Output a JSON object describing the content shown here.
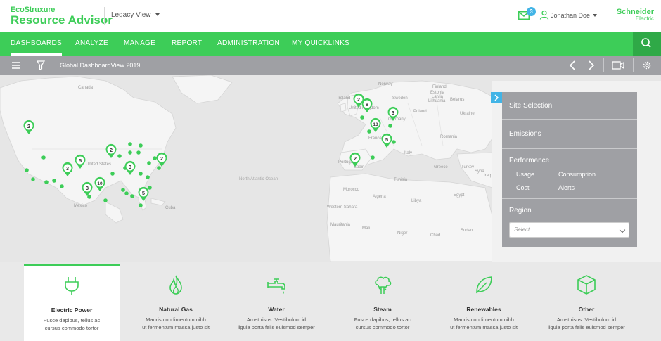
{
  "header": {
    "logo_eco": "EcoStruxure",
    "logo_product": "Resource Advisor",
    "view_selector": "Legacy View",
    "mail_badge": "3",
    "user_name": "Jonathan Doe",
    "brand": "Schneider",
    "brand_sub": "Electric"
  },
  "nav": {
    "items": [
      {
        "label": "DASHBOARDS",
        "active": true
      },
      {
        "label": "ANALYZE",
        "active": false
      },
      {
        "label": "MANAGE",
        "active": false
      },
      {
        "label": "REPORT",
        "active": false
      },
      {
        "label": "ADMINISTRATION",
        "active": false
      },
      {
        "label": "MY QUICKLINKS",
        "active": false
      }
    ]
  },
  "toolbar": {
    "title": "Global DashboardView 2019"
  },
  "map": {
    "labels": {
      "canada": "Canada",
      "united_states": "United States",
      "mexico": "Mexico",
      "sweden": "Sweden",
      "finland": "Finland",
      "norway": "Norway",
      "estonia": "Estonia",
      "latvia": "Latvia",
      "lithuania": "Lithuania",
      "poland": "Poland",
      "ukraine": "Ukraine",
      "germany": "Germany",
      "france": "France",
      "spain": "Spain",
      "portugal": "Portugal",
      "italy": "Italy",
      "turkey": "Turkey",
      "ireland": "Ireland",
      "united_kingdom": "United Kingdom",
      "belarus": "Belarus",
      "romania": "Romania",
      "greece": "Greece",
      "morocco": "Morocco",
      "algeria": "Algeria",
      "libya": "Libya",
      "egypt": "Egypt",
      "tunisia": "Tunisia",
      "syria": "Syria",
      "iraq": "Iraq",
      "cuba": "Cuba",
      "western_sahara": "Western Sahara",
      "mali": "Mali",
      "niger": "Niger",
      "chad": "Chad",
      "sudan": "Sudan",
      "mauritania": "Mauritania",
      "north_atlantic": "North Atlantic Ocean"
    },
    "cluster_counts": [
      "2",
      "5",
      "3",
      "2",
      "3",
      "2",
      "3",
      "10",
      "5",
      "2",
      "8",
      "3",
      "13",
      "5",
      "2"
    ]
  },
  "side_panel": {
    "site_selection": "Site Selection",
    "emissions": "Emissions",
    "performance": "Performance",
    "usage": "Usage",
    "consumption": "Consumption",
    "cost": "Cost",
    "alerts": "Alerts",
    "region": "Region",
    "region_placeholder": "Select"
  },
  "cards": [
    {
      "title": "Electric Power",
      "desc1": "Fusce dapibus, tellus ac",
      "desc2": "cursus commodo tortor",
      "icon": "plug-icon"
    },
    {
      "title": "Natural Gas",
      "desc1": "Mauris condimentum nibh",
      "desc2": "ut fermentum massa justo sit",
      "icon": "flame-icon"
    },
    {
      "title": "Water",
      "desc1": "Amet risus. Vestibulum id",
      "desc2": "ligula porta felis euismod semper",
      "icon": "faucet-icon"
    },
    {
      "title": "Steam",
      "desc1": "Fusce dapibus, tellus ac",
      "desc2": "cursus commodo tortor",
      "icon": "steam-icon"
    },
    {
      "title": "Renewables",
      "desc1": "Mauris condimentum nibh",
      "desc2": "ut fermentum massa justo sit",
      "icon": "leaf-icon"
    },
    {
      "title": "Other",
      "desc1": "Amet risus. Vestibulum id",
      "desc2": "ligula porta felis euismod semper",
      "icon": "cube-icon"
    }
  ],
  "colors": {
    "brand_green": "#3dcd58",
    "toolbar_gray": "#9fa0a4",
    "accent_blue": "#42b4e6"
  }
}
